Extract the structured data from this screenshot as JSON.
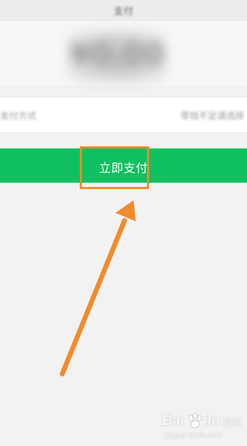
{
  "header": {
    "title": "支付"
  },
  "payment": {
    "amount": "¥0.00"
  },
  "info_row": {
    "left_text": "支付方式",
    "right_text": "零钱不足请选择"
  },
  "pay_button": {
    "label": "立即支付",
    "color": "#10c060"
  },
  "annotation": {
    "highlight_color": "#f28b2c",
    "arrow_color": "#f28b2c"
  },
  "watermark": {
    "brand_left": "Bai",
    "brand_right": "du",
    "suffix": "经验",
    "url": "jingyan.baidu.com"
  }
}
